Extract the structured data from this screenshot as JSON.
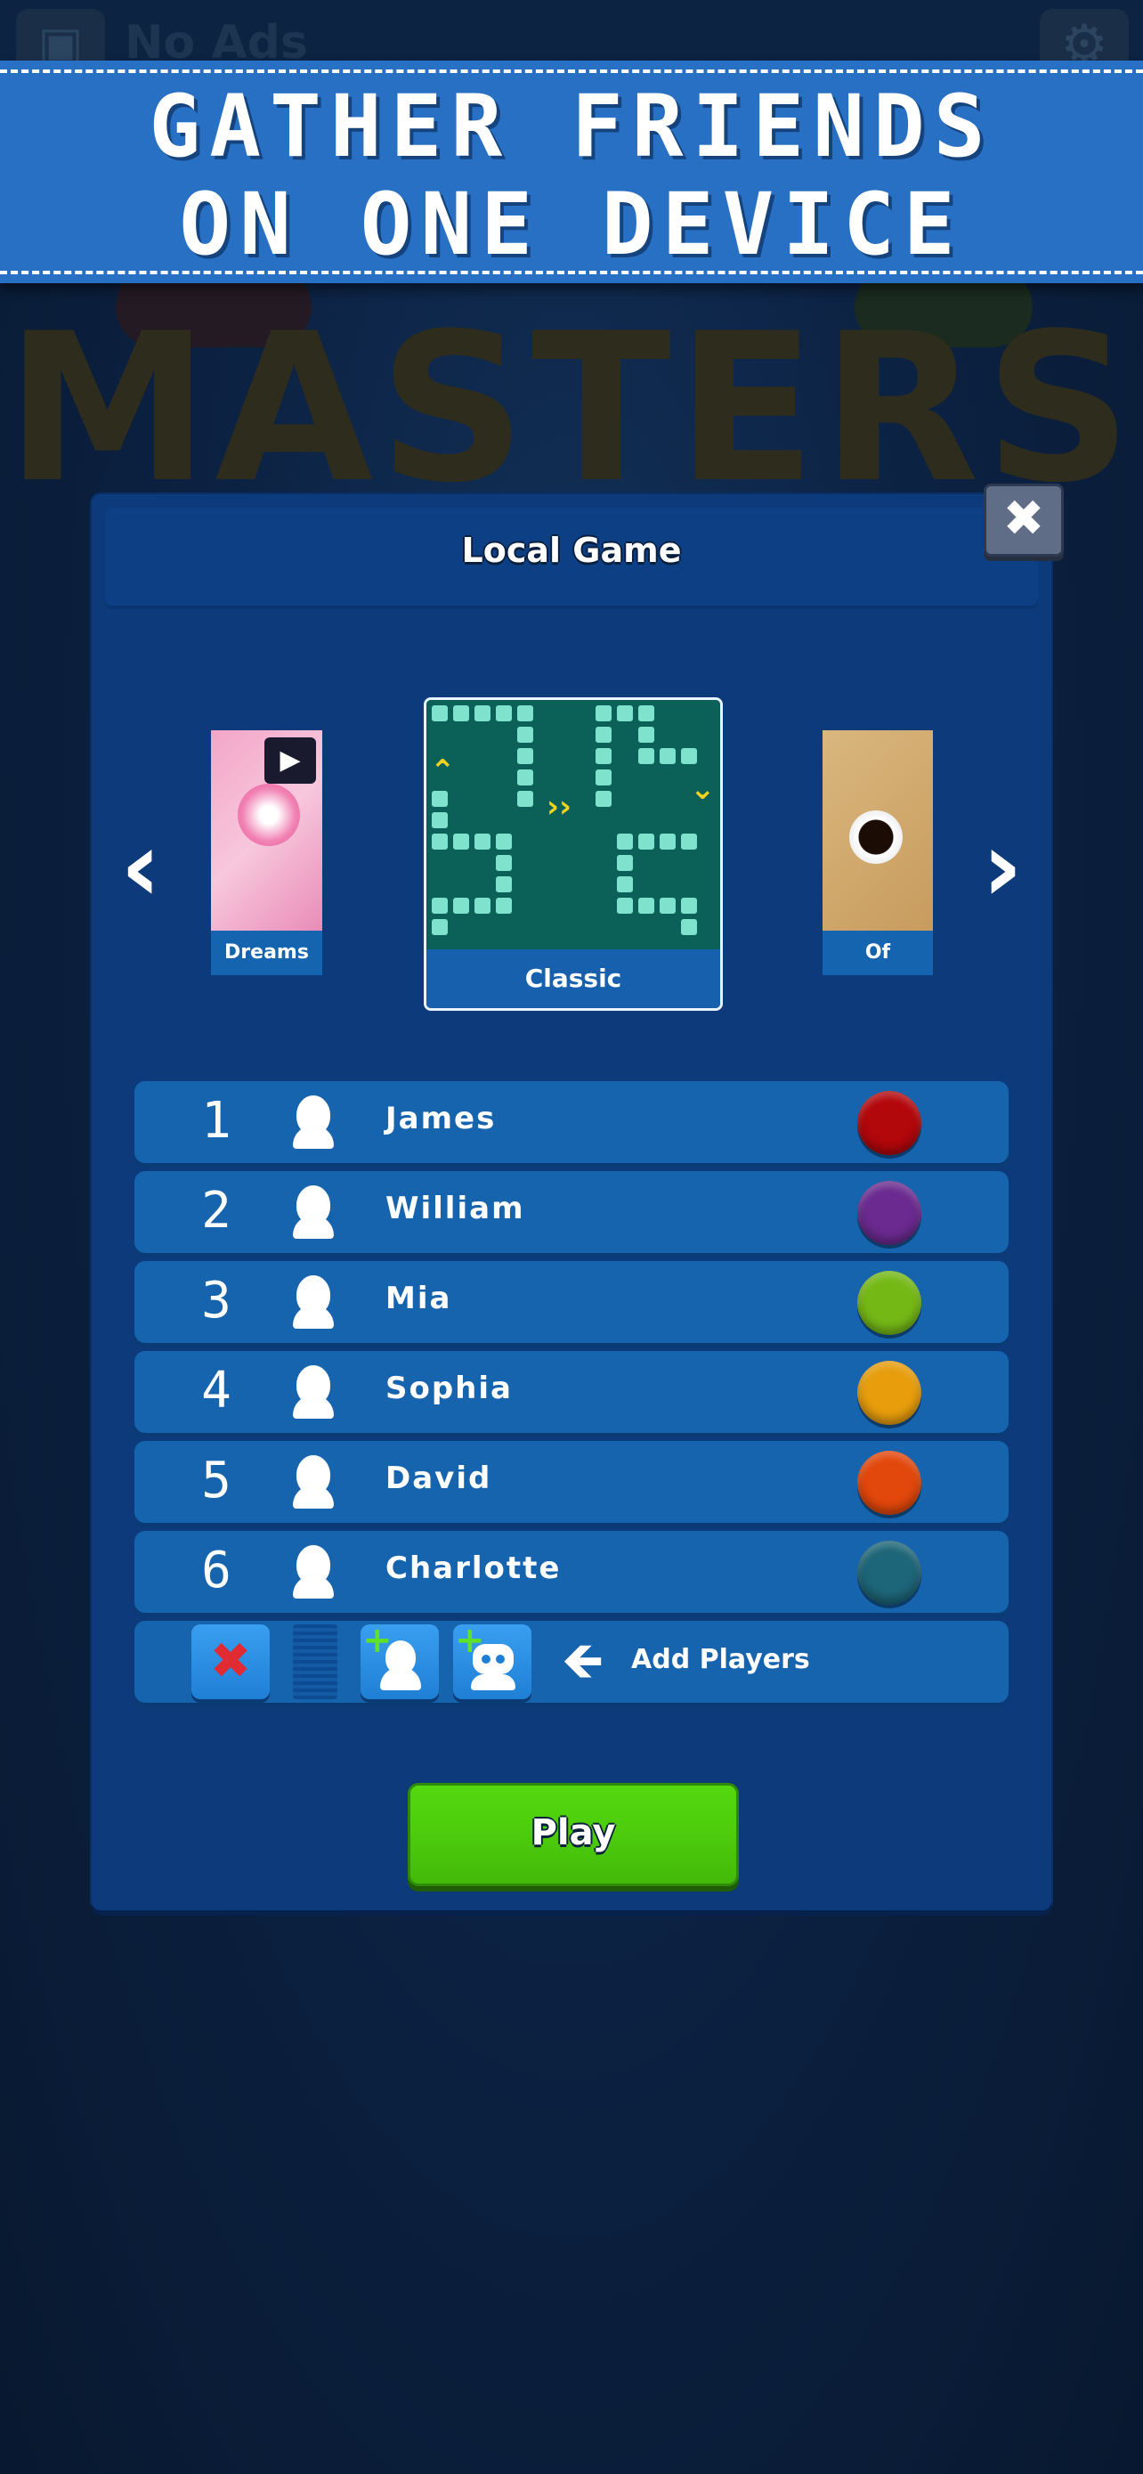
{
  "background": {
    "top_bar": {
      "no_ads_label": "No Ads",
      "clapper_icon": "clapperboard-icon",
      "settings_icon": "gear-icon"
    },
    "logo_text": "MASTERS"
  },
  "banner": {
    "line1": "GATHER FRIENDS",
    "line2": "ON ONE DEVICE"
  },
  "dialog": {
    "title": "Local Game",
    "close_icon": "close-icon",
    "boards": {
      "prev_icon": "chevron-left-icon",
      "next_icon": "chevron-right-icon",
      "items": [
        {
          "label": "Dreams",
          "state": "side"
        },
        {
          "label": "Classic",
          "state": "selected"
        },
        {
          "label": "Of",
          "state": "side"
        }
      ]
    },
    "players": [
      {
        "number": "1",
        "name": "James",
        "color": "#b2070b"
      },
      {
        "number": "2",
        "name": "William",
        "color": "#6a2a8f"
      },
      {
        "number": "3",
        "name": "Mia",
        "color": "#74b816"
      },
      {
        "number": "4",
        "name": "Sophia",
        "color": "#e79d0c"
      },
      {
        "number": "5",
        "name": "David",
        "color": "#e2470b"
      },
      {
        "number": "6",
        "name": "Charlotte",
        "color": "#1d6578"
      }
    ],
    "add_row": {
      "remove_icon": "remove-x-icon",
      "add_human_icon": "add-human-player-icon",
      "add_bot_icon": "add-bot-player-icon",
      "arrow_icon": "arrow-left-icon",
      "label": "Add Players"
    },
    "play_label": "Play"
  },
  "colors": {
    "accent_green": "#4ccc0c",
    "banner_blue": "#2870c4",
    "dialog_blue": "#0c3a7a"
  }
}
